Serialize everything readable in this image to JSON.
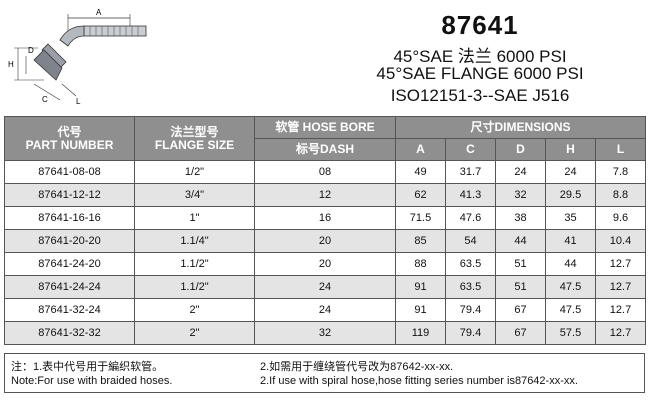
{
  "header": {
    "part_number": "87641",
    "line1": "45°SAE 法兰 6000 PSI",
    "line2": "45°SAE FLANGE 6000 PSI",
    "line3": "ISO12151-3--SAE J516"
  },
  "drawing": {
    "labels": [
      "A",
      "C",
      "D",
      "H",
      "L"
    ]
  },
  "table": {
    "col_part_cn": "代号",
    "col_part_en": "PART NUMBER",
    "col_flange_cn": "法兰型号",
    "col_flange_en": "FLANGE SIZE",
    "col_hose_bore": "软管 HOSE BORE",
    "col_dash": "标号DASH",
    "col_dimensions": "尺寸DIMENSIONS",
    "dims": [
      "A",
      "C",
      "D",
      "H",
      "L"
    ],
    "rows": [
      [
        "87641-08-08",
        "1/2\"",
        "08",
        "49",
        "31.7",
        "24",
        "24",
        "7.8"
      ],
      [
        "87641-12-12",
        "3/4\"",
        "12",
        "62",
        "41.3",
        "32",
        "29.5",
        "8.8"
      ],
      [
        "87641-16-16",
        "1\"",
        "16",
        "71.5",
        "47.6",
        "38",
        "35",
        "9.6"
      ],
      [
        "87641-20-20",
        "1.1/4\"",
        "20",
        "85",
        "54",
        "44",
        "41",
        "10.4"
      ],
      [
        "87641-24-20",
        "1.1/2\"",
        "20",
        "88",
        "63.5",
        "51",
        "44",
        "12.7"
      ],
      [
        "87641-24-24",
        "1.1/2\"",
        "24",
        "91",
        "63.5",
        "51",
        "47.5",
        "12.7"
      ],
      [
        "87641-32-24",
        "2\"",
        "24",
        "91",
        "79.4",
        "67",
        "47.5",
        "12.7"
      ],
      [
        "87641-32-32",
        "2\"",
        "32",
        "119",
        "79.4",
        "67",
        "57.5",
        "12.7"
      ]
    ]
  },
  "notes": {
    "note1_cn": "注：1.表中代号用于編织软管。",
    "note1_en": "Note:For use with braided hoses.",
    "note2_cn": "2.如需用于缠绕管代号改为87642-xx-xx.",
    "note2_en": "2.If use with spiral hose,hose fitting series number is87642-xx-xx."
  }
}
